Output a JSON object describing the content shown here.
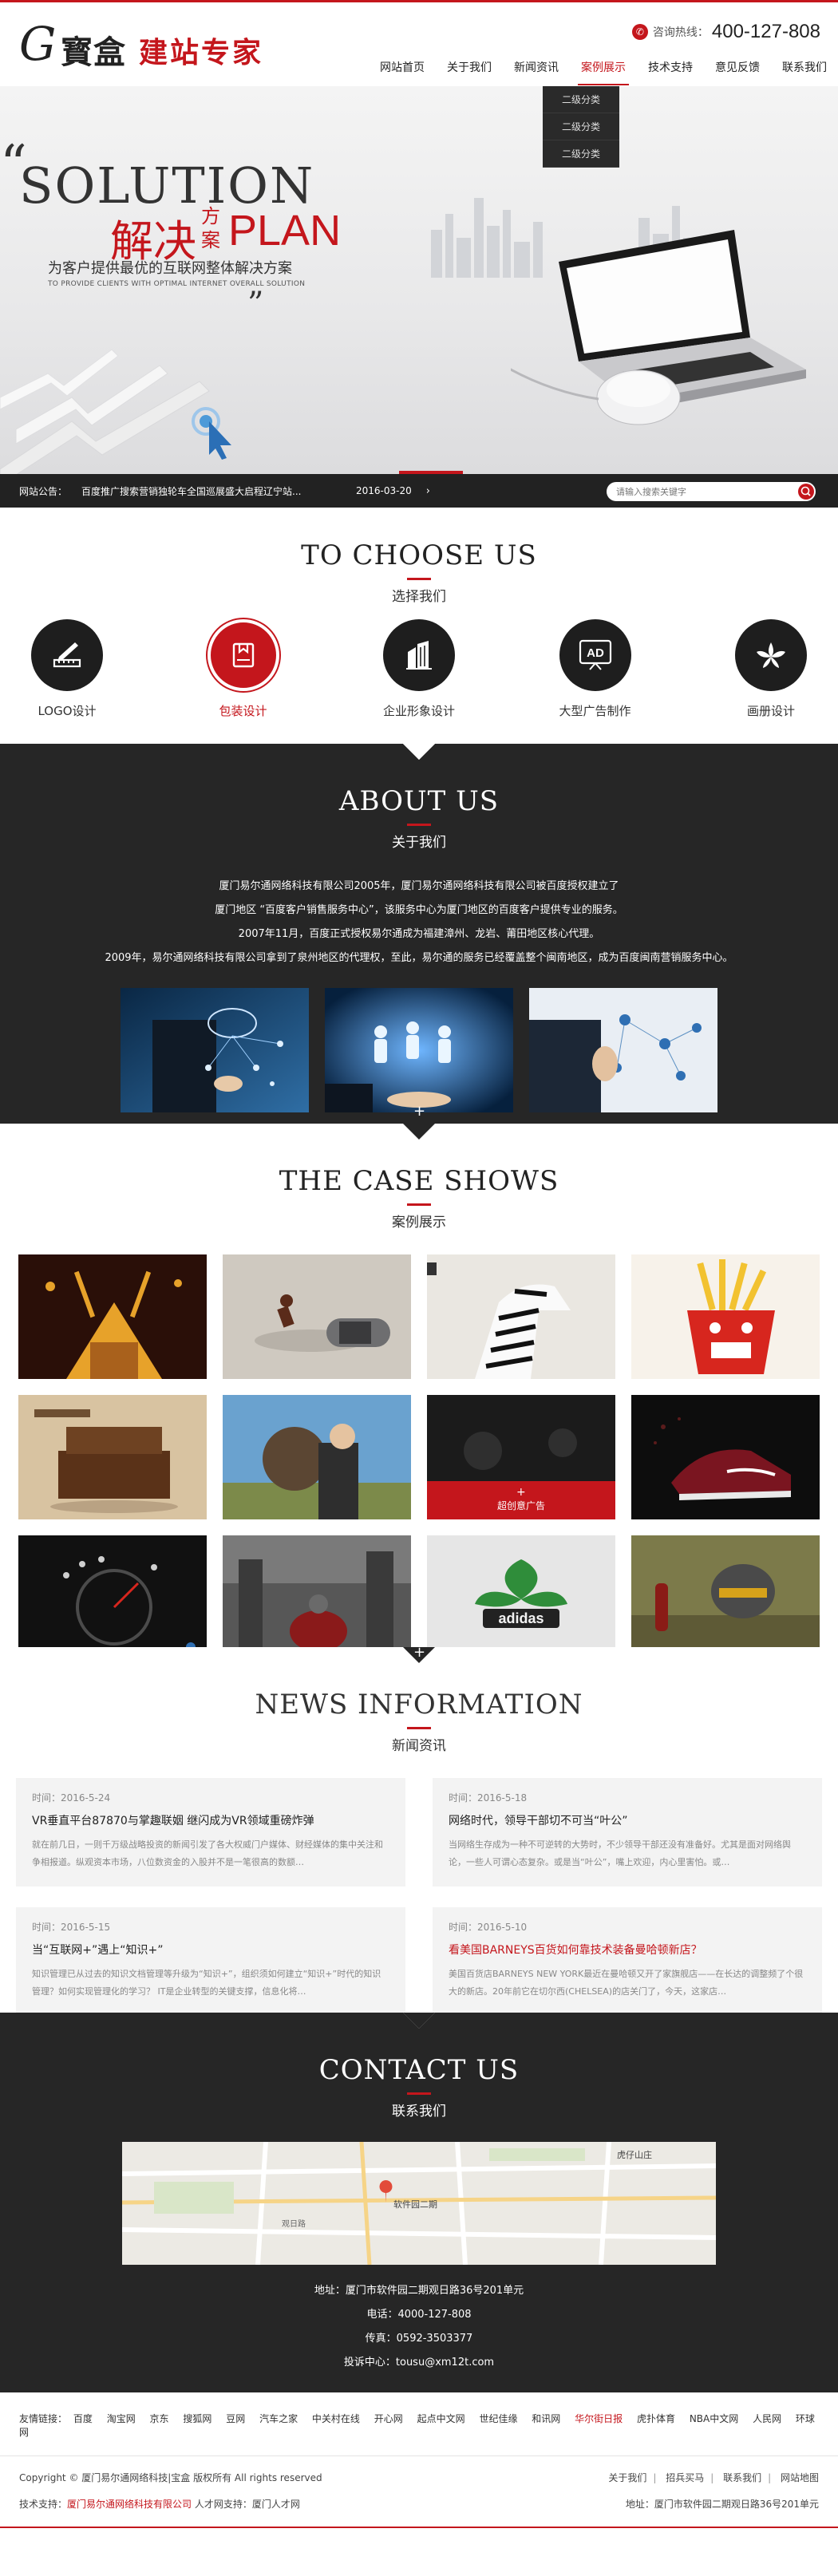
{
  "header": {
    "logo_mark": "G",
    "logo_cn1": "寳盒",
    "logo_cn2": "建站专家",
    "hotline_label": "咨询热线：",
    "hotline_number": "400-127-808",
    "nav": [
      "网站首页",
      "关于我们",
      "新闻资讯",
      "案例展示",
      "技术支持",
      "意见反馈",
      "联系我们"
    ],
    "active_nav_index": 3,
    "dropdown": [
      "二级分类",
      "二级分类",
      "二级分类"
    ]
  },
  "banner": {
    "quote_open": "“",
    "quote_close": "”",
    "solution": "SOLUTION",
    "jiejue": "解决",
    "fangan": "方案",
    "plan": "PLAN",
    "subtitle": "为客户提供最优的互联网整体解决方案",
    "subtitle_en": "TO PROVIDE CLIENTS WITH OPTIMAL INTERNET OVERALL SOLUTION"
  },
  "notice": {
    "label": "网站公告：",
    "text": "百度推广搜索营销独轮车全国巡展盛大启程辽宁站...",
    "date": "2016-03-20",
    "arrow": "›",
    "search_placeholder": "请输入搜索关键字"
  },
  "choose": {
    "title_en": "TO CHOOSE US",
    "title_cn": "选择我们",
    "items": [
      {
        "label": "LOGO设计",
        "icon": "ruler-pencil-icon"
      },
      {
        "label": "包装设计",
        "icon": "package-icon"
      },
      {
        "label": "企业形象设计",
        "icon": "buildings-icon"
      },
      {
        "label": "大型广告制作",
        "icon": "ad-badge-icon",
        "icon_text": "AD"
      },
      {
        "label": "画册设计",
        "icon": "leaf-icon"
      }
    ]
  },
  "about": {
    "title_en": "ABOUT US",
    "title_cn": "关于我们",
    "lines": [
      "厦门易尔通网络科技有限公司2005年，厦门易尔通网络科技有限公司被百度授权建立了",
      "厦门地区 “百度客户销售服务中心”，该服务中心为厦门地区的百度客户提供专业的服务。",
      "2007年11月，百度正式授权易尔通成为福建漳州、龙岩、莆田地区核心代理。",
      "2009年，易尔通网络科技有限公司拿到了泉州地区的代理权，至此，易尔通的服务已经覆盖整个闽南地区，成为百度闽南营销服务中心。"
    ]
  },
  "case": {
    "title_en": "THE CASE SHOWS",
    "title_cn": "案例展示",
    "hover_caption": "超创意广告",
    "hover_plus": "+"
  },
  "news": {
    "title_en": "NEWS INFORMATION",
    "title_cn": "新闻资讯",
    "items": [
      {
        "time": "时间：2016-5-24",
        "title": "VR垂直平台87870与掌趣联姻 继闪成为VR领域重磅炸弹",
        "desc": "就在前几日，一则千万级战略投资的新闻引发了各大权威门户媒体、财经媒体的集中关注和争相报道。纵观资本市场，八位数资金的入股并不是一笔很高的数额…",
        "red": false
      },
      {
        "time": "时间：2016-5-18",
        "title": "网络时代，领导干部切不可当“叶公”",
        "desc": "当网络生存成为一种不可逆转的大势时，不少领导干部还没有准备好。尤其是面对网络舆论，一些人可谓心态复杂。或是当“叶公”，嘴上欢迎，内心里害怕。或…",
        "red": false
      },
      {
        "time": "时间：2016-5-15",
        "title": "当“互联网+”遇上“知识+”",
        "desc": "知识管理已从过去的知识文档管理等升级为“知识+”，组织须如何建立“知识+”时代的知识管理？如何实现管理化的学习？ IT是企业转型的关键支撑，信息化将…",
        "red": false
      },
      {
        "time": "时间：2016-5-10",
        "title": "看美国BARNEYS百货如何靠技术装备曼哈顿新店？",
        "desc": "美国百货店BARNEYS NEW YORK最近在曼哈顿又开了家旗舰店——在长达的调整频了个很大的新店。20年前它在切尔西(CHELSEA)的店关门了，今天，这家店…",
        "red": true
      }
    ]
  },
  "contact": {
    "title_en": "CONTACT US",
    "title_cn": "联系我们",
    "address": "地址：厦门市软件园二期观日路36号201单元",
    "phone": "电话：4000-127-808",
    "fax": "传真：0592-3503377",
    "email": "投诉中心：tousu@xm12t.com",
    "map_labels": [
      "软件园二期",
      "观日路",
      "虎仔山庄"
    ]
  },
  "footer": {
    "links_label": "友情链接：",
    "links": [
      "百度",
      "淘宝网",
      "京东",
      "搜狐网",
      "豆网",
      "汽车之家",
      "中关村在线",
      "开心网",
      "起点中文网",
      "世纪佳缘",
      "和讯网",
      "华尔街日报",
      "虎扑体育",
      "NBA中文网",
      "人民网",
      "环球网"
    ],
    "highlight_link_index": 11,
    "copyright": "Copyright © 厦门易尔通网络科技|宝盒 版权所有 All rights reserved",
    "footer_nav": [
      "关于我们",
      "招兵买马",
      "联系我们",
      "网站地图"
    ],
    "support_label": "技术支持：",
    "support_company": "厦门易尔通网络科技有限公司",
    "talent_text": "人才网支持：厦门人才网",
    "address": "地址：厦门市软件园二期观日路36号201单元"
  },
  "colors": {
    "brand_red": "#c4161c",
    "dark": "#262626"
  }
}
